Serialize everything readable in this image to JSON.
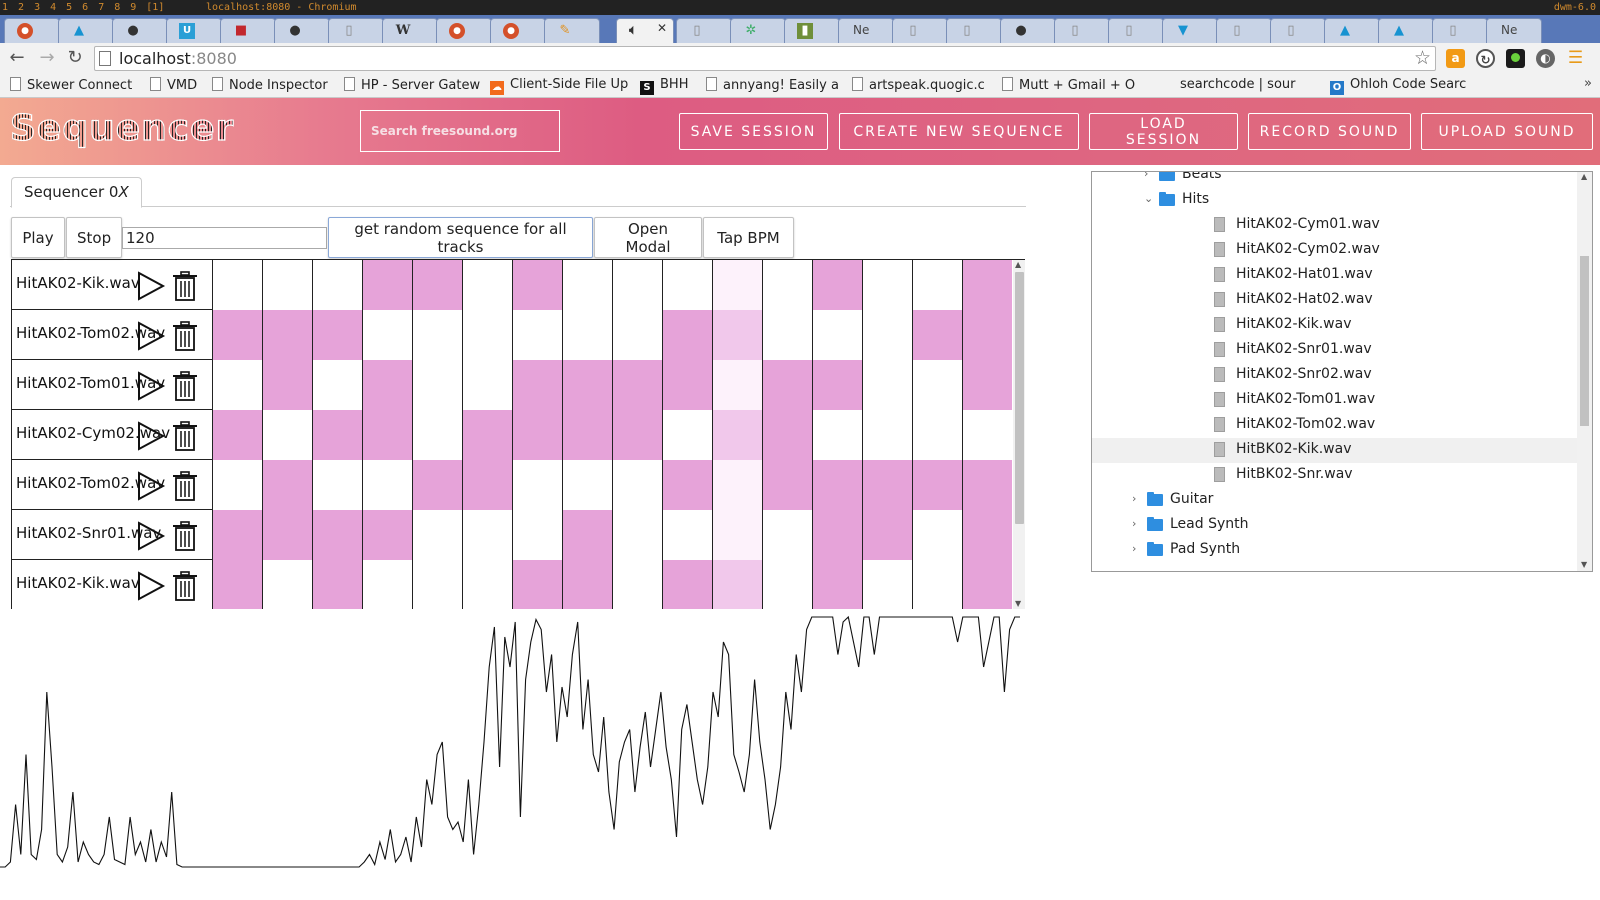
{
  "wm": {
    "tags": [
      "1",
      "2",
      "3",
      "4",
      "5",
      "6",
      "7",
      "8",
      "9",
      "[1]"
    ],
    "window_title": "localhost:8080 - Chromium",
    "version": "dwm-6.0"
  },
  "browser": {
    "tab_labels": {
      "tab_ne_1": "Ne",
      "tab_ne_2": "Ne"
    },
    "url_host": "localhost",
    "url_port": ":8080",
    "bookmarks": [
      "Skewer Connect",
      "VMD",
      "Node Inspector",
      "HP - Server Gatew",
      "Client-Side File Up",
      "BHH",
      "annyang! Easily a",
      "artspeak.quogic.c",
      "Mutt + Gmail + O",
      "searchcode | sour",
      "Ohloh Code Searc"
    ],
    "bookmark_more": "»"
  },
  "header": {
    "logo": "Sequencer",
    "search_placeholder": "Search freesound.org",
    "buttons": {
      "save": "SAVE SESSION",
      "create": "CREATE NEW SEQUENCE",
      "load": "LOAD SESSION",
      "record": "RECORD SOUND",
      "upload": "UPLOAD SOUND"
    }
  },
  "sequencer": {
    "tab_label_prefix": "Sequencer 0",
    "tab_label_suffix": "X",
    "controls": {
      "play": "Play",
      "stop": "Stop",
      "bpm": "120",
      "random": "get random sequence for all tracks",
      "modal": "Open Modal",
      "tap": "Tap BPM"
    },
    "active_step": 10,
    "colors": {
      "on": "#e6a3d9",
      "off": "#ffffff",
      "playhead_on": "#f1c8eb",
      "playhead_off": "#fdf2fb"
    },
    "tracks": [
      {
        "name": "HitAK02-Kik.wav",
        "steps": [
          0,
          0,
          0,
          1,
          1,
          0,
          1,
          0,
          0,
          0,
          0,
          0,
          1,
          0,
          0,
          1
        ]
      },
      {
        "name": "HitAK02-Tom02.wav",
        "steps": [
          1,
          1,
          1,
          0,
          0,
          0,
          0,
          0,
          0,
          1,
          1,
          0,
          0,
          0,
          1,
          1
        ]
      },
      {
        "name": "HitAK02-Tom01.wav",
        "steps": [
          0,
          1,
          0,
          1,
          0,
          0,
          1,
          1,
          1,
          1,
          0,
          1,
          1,
          0,
          0,
          1
        ]
      },
      {
        "name": "HitAK02-Cym02.wav",
        "steps": [
          1,
          0,
          1,
          1,
          0,
          1,
          1,
          1,
          1,
          0,
          1,
          1,
          0,
          0,
          0,
          0
        ]
      },
      {
        "name": "HitAK02-Tom02.wav",
        "steps": [
          0,
          1,
          0,
          0,
          1,
          1,
          0,
          0,
          0,
          1,
          0,
          1,
          1,
          1,
          1,
          1
        ]
      },
      {
        "name": "HitAK02-Snr01.wav",
        "steps": [
          1,
          1,
          1,
          1,
          0,
          0,
          0,
          1,
          0,
          0,
          0,
          0,
          1,
          1,
          0,
          1
        ]
      },
      {
        "name": "HitAK02-Kik.wav",
        "steps": [
          1,
          0,
          1,
          0,
          0,
          0,
          1,
          1,
          0,
          1,
          1,
          0,
          1,
          0,
          0,
          1
        ]
      }
    ]
  },
  "waveform": {
    "samples": [
      0,
      0,
      0.02,
      0.25,
      0.05,
      0.45,
      0.05,
      0.03,
      0.15,
      0.7,
      0.4,
      0.05,
      0.02,
      0.08,
      0.3,
      0.02,
      0.1,
      0.05,
      0.02,
      0.01,
      0.05,
      0.2,
      0.03,
      0.02,
      0.01,
      0.2,
      0.05,
      0.1,
      0.02,
      0.15,
      0.02,
      0.1,
      0.04,
      0.3,
      0.01,
      0,
      0,
      0,
      0,
      0,
      0,
      0,
      0,
      0,
      0,
      0,
      0,
      0,
      0,
      0,
      0,
      0,
      0,
      0,
      0,
      0,
      0,
      0,
      0,
      0,
      0,
      0,
      0,
      0,
      0,
      0,
      0,
      0,
      0,
      0,
      0.02,
      0.05,
      0.01,
      0.1,
      0.03,
      0.15,
      0.02,
      0.05,
      0.12,
      0.02,
      0.2,
      0.08,
      0.35,
      0.25,
      0.45,
      0.5,
      0.2,
      0.15,
      0.18,
      0.1,
      0.35,
      0.05,
      0.25,
      0.5,
      0.8,
      0.96,
      0.4,
      0.92,
      0.8,
      0.98,
      0.2,
      0.75,
      0.9,
      0.99,
      0.95,
      0.7,
      0.85,
      0.5,
      0.72,
      0.6,
      0.85,
      0.98,
      0.55,
      0.75,
      0.45,
      0.38,
      0.6,
      0.3,
      0.15,
      0.42,
      0.5,
      0.55,
      0.3,
      0.48,
      0.62,
      0.4,
      0.55,
      0.7,
      0.48,
      0.35,
      0.12,
      0.55,
      0.65,
      0.5,
      0.35,
      0.25,
      0.4,
      0.7,
      0.6,
      0.9,
      0.85,
      0.45,
      0.38,
      0.3,
      0.45,
      0.75,
      0.5,
      0.35,
      0.15,
      0.25,
      0.4,
      0.7,
      0.55,
      0.85,
      0.7,
      0.95,
      1,
      1,
      1,
      1,
      1,
      0.85,
      0.98,
      1,
      0.9,
      0.8,
      1,
      1,
      0.85,
      1,
      1,
      1,
      1,
      1,
      1,
      1,
      1,
      1,
      1,
      1,
      1,
      1,
      1,
      1,
      0.9,
      1,
      1,
      1,
      1,
      0.8,
      0.9,
      1,
      1,
      0.7,
      0.95,
      1,
      1
    ]
  },
  "filetree": {
    "nodes": [
      {
        "label": "Beats",
        "type": "folder",
        "expanded": false,
        "depth": 1,
        "hover": false
      },
      {
        "label": "Hits",
        "type": "folder",
        "expanded": true,
        "depth": 1,
        "hover": false
      },
      {
        "label": "HitAK02-Cym01.wav",
        "type": "file",
        "depth": 2,
        "hover": false
      },
      {
        "label": "HitAK02-Cym02.wav",
        "type": "file",
        "depth": 2,
        "hover": false
      },
      {
        "label": "HitAK02-Hat01.wav",
        "type": "file",
        "depth": 2,
        "hover": false
      },
      {
        "label": "HitAK02-Hat02.wav",
        "type": "file",
        "depth": 2,
        "hover": false
      },
      {
        "label": "HitAK02-Kik.wav",
        "type": "file",
        "depth": 2,
        "hover": false
      },
      {
        "label": "HitAK02-Snr01.wav",
        "type": "file",
        "depth": 2,
        "hover": false
      },
      {
        "label": "HitAK02-Snr02.wav",
        "type": "file",
        "depth": 2,
        "hover": false
      },
      {
        "label": "HitAK02-Tom01.wav",
        "type": "file",
        "depth": 2,
        "hover": false
      },
      {
        "label": "HitAK02-Tom02.wav",
        "type": "file",
        "depth": 2,
        "hover": false
      },
      {
        "label": "HitBK02-Kik.wav",
        "type": "file",
        "depth": 2,
        "hover": true
      },
      {
        "label": "HitBK02-Snr.wav",
        "type": "file",
        "depth": 2,
        "hover": false
      },
      {
        "label": "Guitar",
        "type": "folder",
        "expanded": false,
        "depth": 0,
        "hover": false
      },
      {
        "label": "Lead Synth",
        "type": "folder",
        "expanded": false,
        "depth": 0,
        "hover": false
      },
      {
        "label": "Pad Synth",
        "type": "folder",
        "expanded": false,
        "depth": 0,
        "hover": false
      }
    ]
  }
}
